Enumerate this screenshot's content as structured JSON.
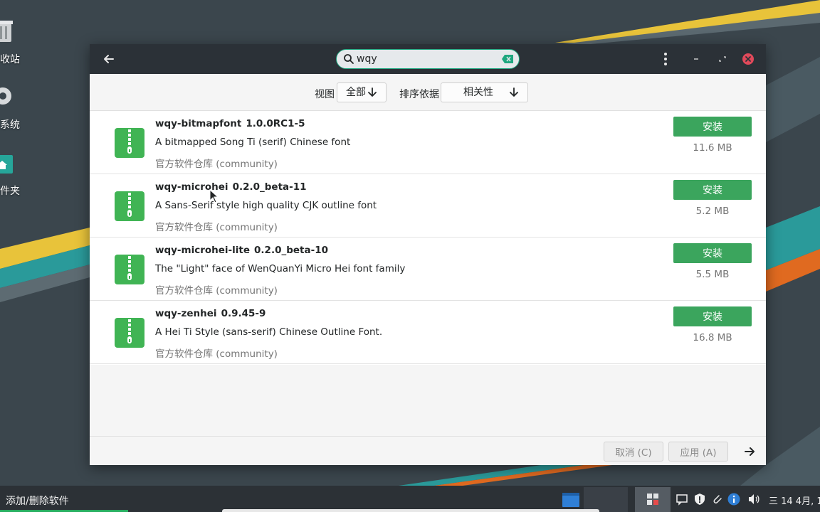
{
  "desktop": {
    "icons": [
      {
        "label": "收站",
        "icon": "trash-icon"
      },
      {
        "label": "系统",
        "icon": "system-icon"
      },
      {
        "label": "件夹",
        "icon": "home-folder-icon"
      }
    ]
  },
  "window": {
    "search": {
      "value": "wqy"
    },
    "toolbar": {
      "view_label": "视图",
      "view_value": "全部",
      "sort_label": "排序依据",
      "sort_value": "相关性"
    },
    "packages": [
      {
        "name": "wqy-bitmapfont",
        "version": "1.0.0RC1-5",
        "description": "A bitmapped Song Ti (serif) Chinese font",
        "repo": "官方软件仓库 (community)",
        "size": "11.6 MB",
        "action": "安装"
      },
      {
        "name": "wqy-microhei",
        "version": "0.2.0_beta-11",
        "description": "A Sans-Serif style high quality CJK outline font",
        "repo": "官方软件仓库 (community)",
        "size": "5.2 MB",
        "action": "安装"
      },
      {
        "name": "wqy-microhei-lite",
        "version": "0.2.0_beta-10",
        "description": "The \"Light\" face of WenQuanYi Micro Hei font family",
        "repo": "官方软件仓库 (community)",
        "size": "5.5 MB",
        "action": "安装"
      },
      {
        "name": "wqy-zenhei",
        "version": "0.9.45-9",
        "description": "A Hei Ti Style (sans-serif) Chinese Outline Font.",
        "repo": "官方软件仓库 (community)",
        "size": "16.8 MB",
        "action": "安装"
      }
    ],
    "bottom": {
      "cancel_label": "取消 (C)",
      "apply_label": "应用 (A)"
    }
  },
  "taskbar": {
    "active_task": "添加/删除软件",
    "clock": "三 14 4月, 1"
  },
  "colors": {
    "accent_green": "#3ba55d",
    "search_border": "#1ea77f",
    "titlebar": "#2b3137",
    "close": "#e0495a"
  }
}
